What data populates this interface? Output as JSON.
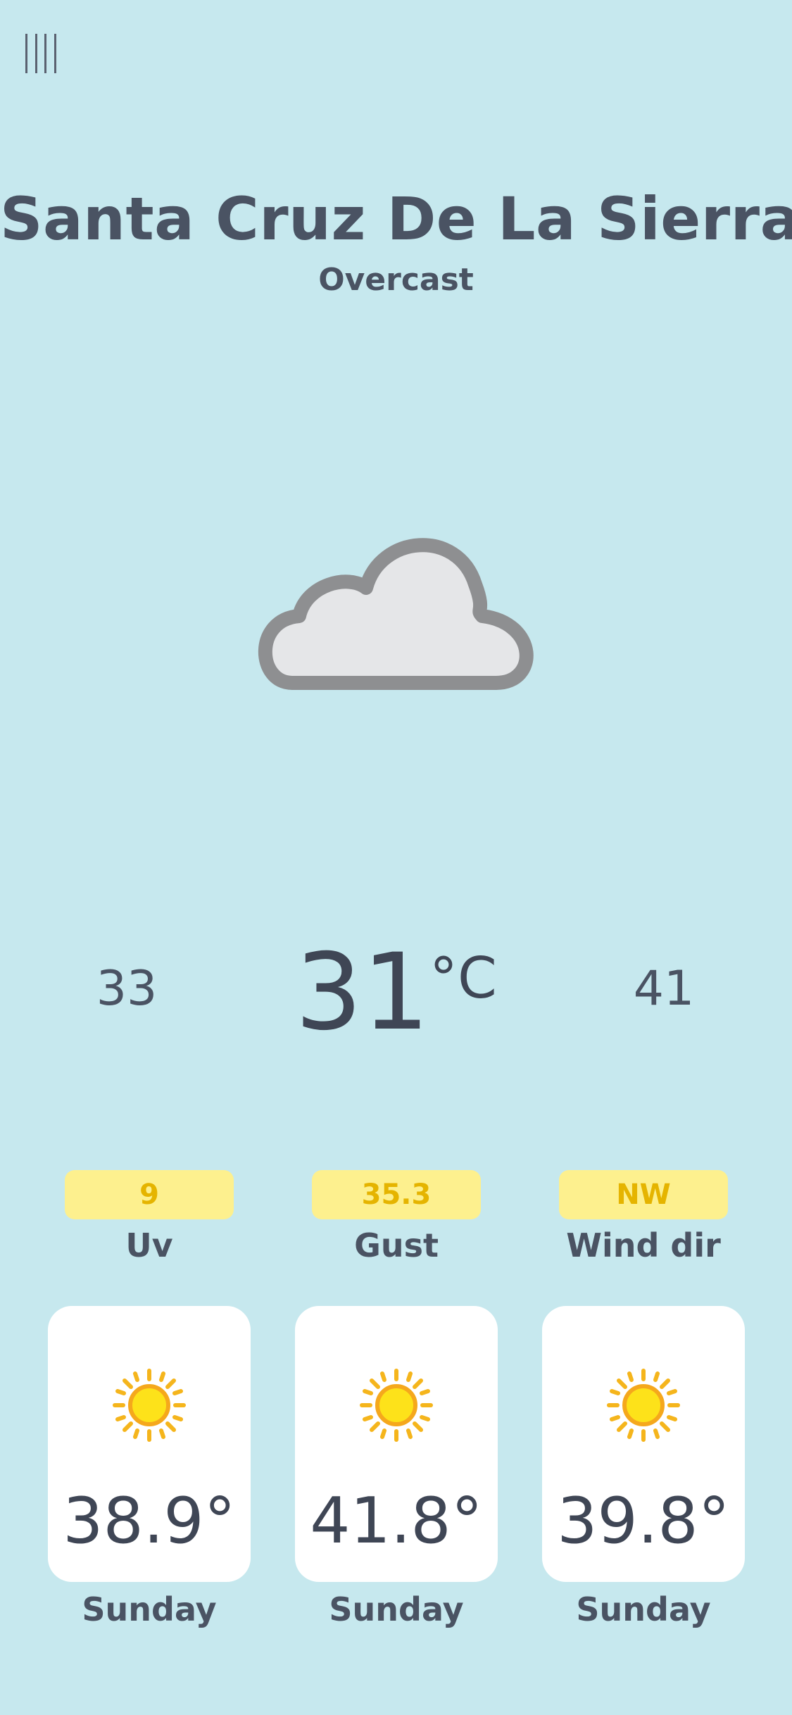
{
  "header": {
    "city": "Santa Cruz De La Sierra",
    "condition": "Overcast"
  },
  "current": {
    "icon": "cloud-icon",
    "min": "33",
    "temp": "31",
    "unit": "°C",
    "max": "41"
  },
  "stats": [
    {
      "value": "9",
      "label": "Uv"
    },
    {
      "value": "35.3",
      "label": "Gust"
    },
    {
      "value": "NW",
      "label": "Wind dir"
    }
  ],
  "forecast": [
    {
      "temp": "38.9°",
      "day": "Sunday",
      "icon": "sun-icon"
    },
    {
      "temp": "41.8°",
      "day": "Sunday",
      "icon": "sun-icon"
    },
    {
      "temp": "39.8°",
      "day": "Sunday",
      "icon": "sun-icon"
    }
  ],
  "colors": {
    "background": "#c6e8ee",
    "pill": "#fdf08e",
    "pill_text": "#e5b400",
    "text": "#4a5363",
    "card": "#ffffff"
  }
}
